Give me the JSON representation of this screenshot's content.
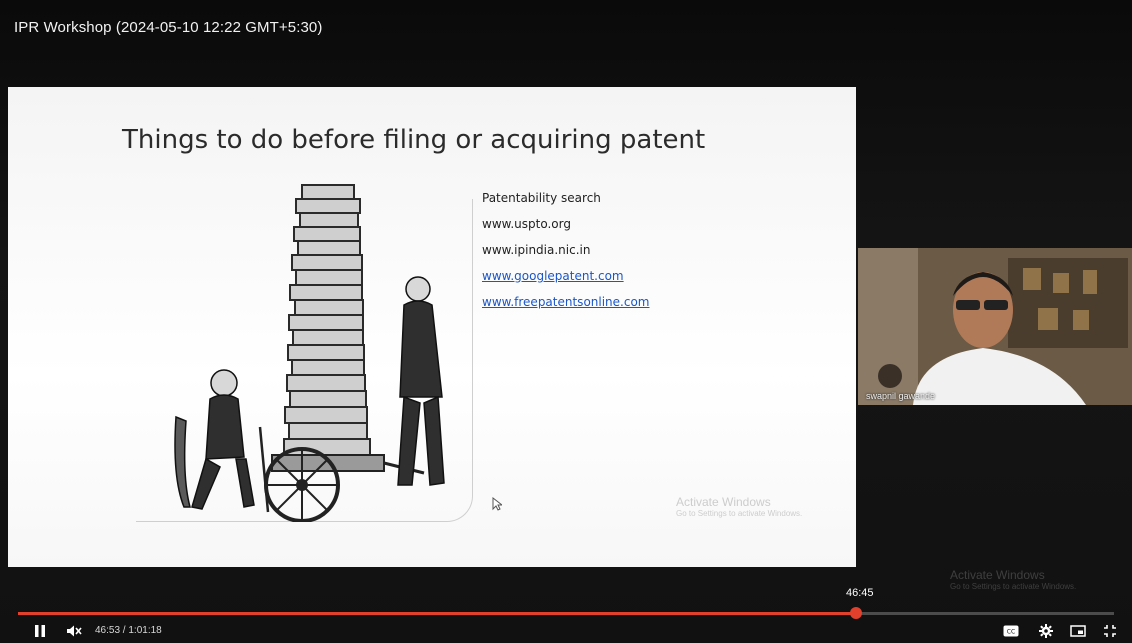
{
  "player": {
    "title": "IPR Workshop (2024-05-10 12:22 GMT+5:30)",
    "current_time": "46:53",
    "separator": " / ",
    "duration": "1:01:18",
    "hover_time": "46:45",
    "progress": 0.765,
    "accent_color": "#e0402c"
  },
  "slide": {
    "title": "Things to do before filing or acquiring patent",
    "items": [
      {
        "text": "Patentability search",
        "link": false
      },
      {
        "text": "www.uspto.org",
        "link": false
      },
      {
        "text": "www.ipindia.nic.in",
        "link": false
      },
      {
        "text": "www.googlepatent.com",
        "link": true
      },
      {
        "text": "www.freepatentsonline.com",
        "link": true
      }
    ],
    "illustration": "two men with a cart of stacked books",
    "watermark_title": "Activate Windows",
    "watermark_sub": "Go to Settings to activate Windows."
  },
  "participant": {
    "name": "swapnil gawande"
  },
  "player_watermark": {
    "title": "Activate Windows",
    "sub": "Go to Settings to activate Windows."
  },
  "icons": {
    "play_pause": "pause-icon",
    "volume": "volume-muted-icon",
    "captions": "captions-icon",
    "settings": "gear-icon",
    "miniplayer": "miniplayer-icon",
    "fullscreen": "exit-fullscreen-icon"
  }
}
